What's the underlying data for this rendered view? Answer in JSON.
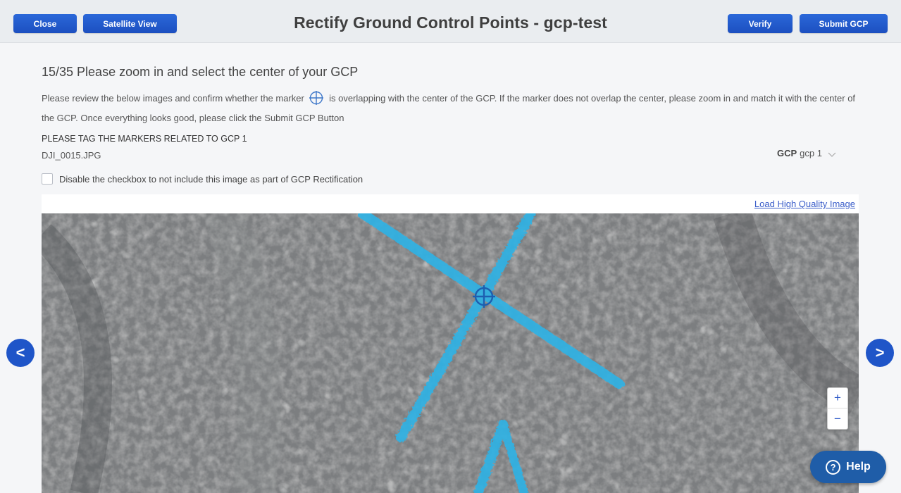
{
  "header": {
    "title": "Rectify Ground Control Points - gcp-test",
    "close_label": "Close",
    "satellite_label": "Satellite View",
    "verify_label": "Verify",
    "submit_label": "Submit GCP"
  },
  "main": {
    "heading": "15/35 Please zoom in and select the center of your GCP",
    "instructions_before": "Please review the below images and confirm whether the marker",
    "instructions_after": "is overlapping with the center of the GCP. If the marker does not overlap the center, please zoom in and match it with the center of the GCP. Once everything looks good, please click the Submit GCP Button",
    "tag_heading": "PLEASE TAG THE MARKERS RELATED TO GCP 1",
    "filename": "DJI_0015.JPG",
    "gcp_label": "GCP",
    "gcp_value": "gcp 1",
    "checkbox_label": "Disable the checkbox to not include this image as part of GCP Rectification",
    "checkbox_checked": false,
    "hq_link": "Load High Quality Image"
  },
  "controls": {
    "zoom_in": "+",
    "zoom_out": "−",
    "prev": "<",
    "next": ">",
    "help_label": "Help",
    "help_icon": "?"
  },
  "icons": {
    "marker": "crosshair-icon",
    "dropdown": "chevron-down-icon",
    "help": "question-circle-icon"
  },
  "colors": {
    "primary": "#1f55c8",
    "marker": "#1d5fb0",
    "paint": "#2fb3e6"
  }
}
